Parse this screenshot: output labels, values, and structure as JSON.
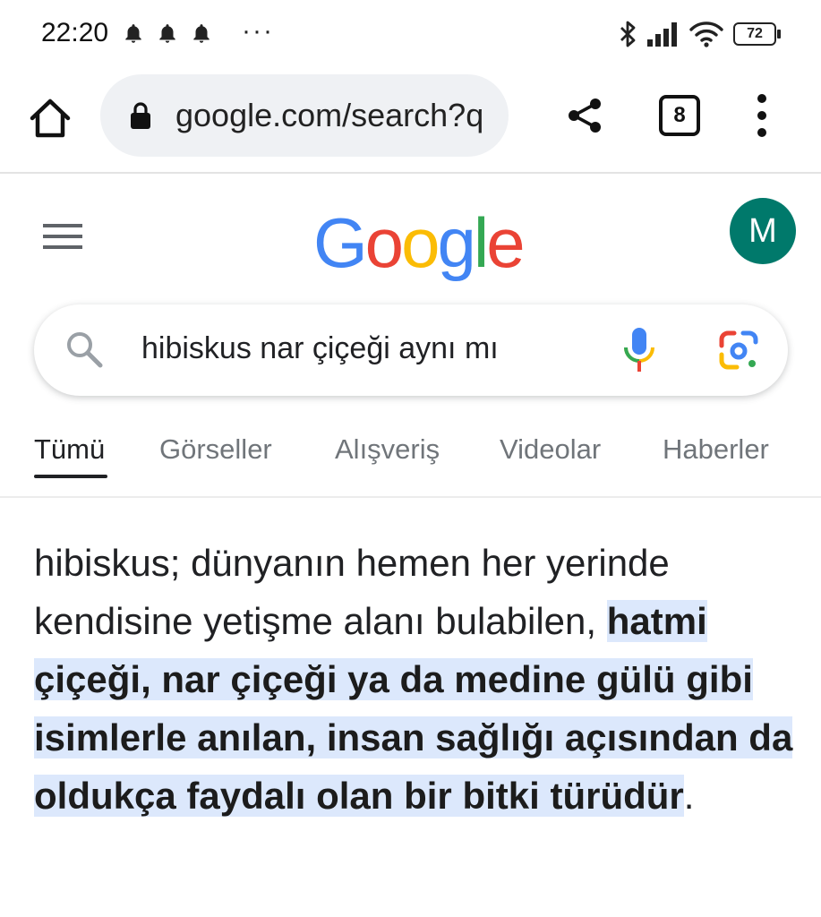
{
  "status_bar": {
    "time": "22:20",
    "notification_icons": [
      "bell-icon",
      "bell-icon",
      "bell-icon"
    ],
    "more": "···",
    "battery": "72",
    "system_icons": [
      "bluetooth-icon",
      "signal-icon",
      "wifi-icon",
      "battery-icon"
    ]
  },
  "browser": {
    "url": "google.com/search?q",
    "tab_count": "8"
  },
  "google": {
    "logo_letters": [
      "G",
      "o",
      "o",
      "g",
      "l",
      "e"
    ],
    "logo_colors": [
      "#4285F4",
      "#EA4335",
      "#FBBC05",
      "#4285F4",
      "#34A853",
      "#EA4335"
    ],
    "avatar_letter": "M",
    "avatar_color": "#00796b"
  },
  "search": {
    "query": "hibiskus nar çiçeği aynı mı"
  },
  "tabs": [
    {
      "label": "Tümü",
      "active": true
    },
    {
      "label": "Görseller",
      "active": false
    },
    {
      "label": "Alışveriş",
      "active": false
    },
    {
      "label": "Videolar",
      "active": false
    },
    {
      "label": "Haberler",
      "active": false
    }
  ],
  "answer": {
    "plain": "hibiskus; dünyanın hemen her yerinde kendisine yetişme alanı bulabilen, ",
    "highlighted": "hatmi çiçeği, nar çiçeği ya da medine gülü gibi isimlerle anılan, insan sağlığı açısından da oldukça faydalı olan bir bitki türüdür",
    "end": "."
  }
}
